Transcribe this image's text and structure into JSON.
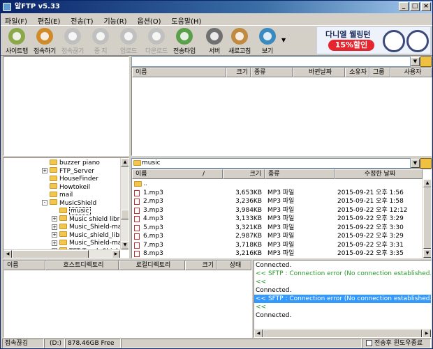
{
  "window": {
    "title": "알FTP v5.33",
    "controls": {
      "minimize": "_",
      "maximize": "□",
      "close": "×"
    }
  },
  "menu": [
    "파일(F)",
    "편집(E)",
    "전송(T)",
    "기능(R)",
    "옵션(O)",
    "도움말(H)"
  ],
  "toolbar": [
    {
      "label": "사이트맵",
      "icon": "sitemap-icon",
      "enabled": true,
      "color": "#8aa84a"
    },
    {
      "label": "접속하기",
      "icon": "connect-icon",
      "enabled": true,
      "color": "#d08a2a"
    },
    {
      "label": "접속끊기",
      "icon": "disconnect-icon",
      "enabled": false,
      "color": "#c0c0c0"
    },
    {
      "label": "중 지",
      "icon": "stop-icon",
      "enabled": false,
      "color": "#c0c0c0"
    },
    {
      "label": "업로드",
      "icon": "upload-icon",
      "enabled": false,
      "color": "#c0c0c0"
    },
    {
      "label": "다운로드",
      "icon": "download-icon",
      "enabled": false,
      "color": "#c0c0c0"
    },
    {
      "label": "전송타입",
      "icon": "transfer-type-icon",
      "enabled": true,
      "color": "#5aa04a"
    },
    {
      "label": "서버",
      "icon": "server-icon",
      "enabled": true,
      "color": "#707070"
    },
    {
      "label": "새로고침",
      "icon": "refresh-icon",
      "enabled": true,
      "color": "#c08a40"
    },
    {
      "label": "보기",
      "icon": "view-icon",
      "enabled": true,
      "color": "#3a8ac0"
    }
  ],
  "ad": {
    "title": "다니엘 웰링턴",
    "discount": "15%할인"
  },
  "remote": {
    "path": "",
    "columns": [
      "이름",
      "크기",
      "종류",
      "바뀐날짜",
      "소유자",
      "그룹",
      "사용자"
    ]
  },
  "local_tree": {
    "items": [
      {
        "name": "buzzer piano",
        "expand": ""
      },
      {
        "name": "FTP_Server",
        "expand": "+"
      },
      {
        "name": "HouseFinder",
        "expand": ""
      },
      {
        "name": "Howtokeil",
        "expand": ""
      },
      {
        "name": "mail",
        "expand": ""
      },
      {
        "name": "MusicShield",
        "expand": "-"
      },
      {
        "name": "music",
        "expand": ""
      },
      {
        "name": "Music shield libra",
        "expand": "+"
      },
      {
        "name": "Music_Shield-ma",
        "expand": "+"
      },
      {
        "name": "Music_shield_libr",
        "expand": "+"
      },
      {
        "name": "Music_Shield-ma",
        "expand": "+"
      },
      {
        "name": "TFT Touch Shield",
        "expand": "+"
      }
    ]
  },
  "local": {
    "path": "music",
    "columns": [
      "이름",
      "/",
      "크기",
      "종류",
      "수정한 날짜"
    ],
    "files": [
      {
        "name": "..",
        "size": "",
        "type": "",
        "date": ""
      },
      {
        "name": "1.mp3",
        "size": "3,653KB",
        "type": "MP3 파일",
        "date": "2015-09-21 오후 1:56"
      },
      {
        "name": "2.mp3",
        "size": "3,236KB",
        "type": "MP3 파일",
        "date": "2015-09-21 오후 1:58"
      },
      {
        "name": "3.mp3",
        "size": "3,984KB",
        "type": "MP3 파일",
        "date": "2015-09-22 오후 12:12"
      },
      {
        "name": "4.mp3",
        "size": "3,133KB",
        "type": "MP3 파일",
        "date": "2015-09-22 오후 3:29"
      },
      {
        "name": "5.mp3",
        "size": "3,321KB",
        "type": "MP3 파일",
        "date": "2015-09-22 오후 3:30"
      },
      {
        "name": "6.mp3",
        "size": "2,987KB",
        "type": "MP3 파일",
        "date": "2015-09-22 오후 3:29"
      },
      {
        "name": "7.mp3",
        "size": "3,718KB",
        "type": "MP3 파일",
        "date": "2015-09-22 오후 3:31"
      },
      {
        "name": "8.mp3",
        "size": "3,216KB",
        "type": "MP3 파일",
        "date": "2015-09-22 오후 3:35"
      }
    ]
  },
  "queue": {
    "columns": [
      "이름",
      "호스트디렉토리",
      "로컬디렉토리",
      "크기",
      "상태"
    ]
  },
  "log": [
    {
      "text": "Connected.",
      "color": "#000000",
      "selected": false
    },
    {
      "text": "<< SFTP : Connection error (No connection established.)",
      "color": "#2a9a2a",
      "selected": false
    },
    {
      "text": "<<",
      "color": "#2a9a2a",
      "selected": false
    },
    {
      "text": "Connected.",
      "color": "#000000",
      "selected": false
    },
    {
      "text": "<< SFTP : Connection error (No connection established.)",
      "color": "#ffffff",
      "selected": true
    },
    {
      "text": "<<",
      "color": "#2a9a2a",
      "selected": false
    },
    {
      "text": "Connected.",
      "color": "#000000",
      "selected": false
    }
  ],
  "status": {
    "connection": "접속끊김",
    "drive": "(D:)",
    "free": "878.46GB Free",
    "option": "전송후 윈도우종료"
  }
}
